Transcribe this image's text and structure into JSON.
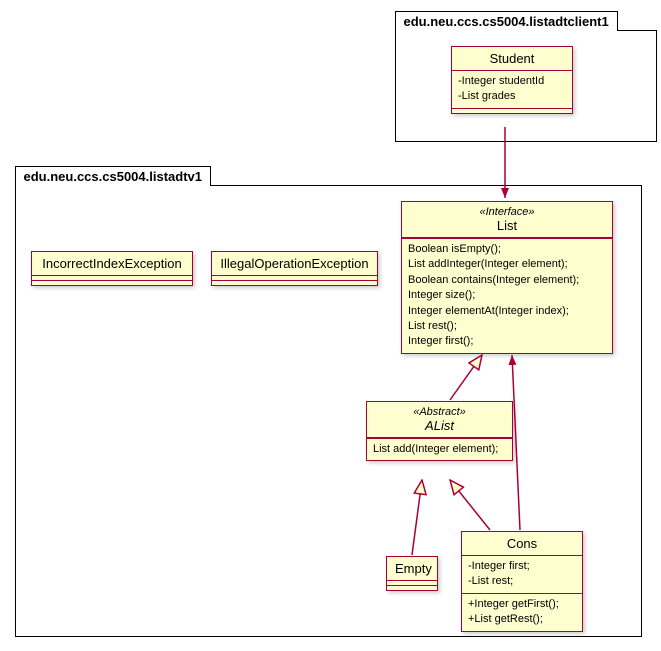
{
  "packages": {
    "client": {
      "name": "edu.neu.ccs.cs5004.listadtclient1"
    },
    "adt": {
      "name": "edu.neu.ccs.cs5004.listadtv1"
    }
  },
  "classes": {
    "student": {
      "name": "Student",
      "fields": [
        "-Integer studentId",
        "-List grades"
      ]
    },
    "incorrectIndex": {
      "name": "IncorrectIndexException"
    },
    "illegalOp": {
      "name": "IllegalOperationException"
    },
    "list": {
      "stereo": "«Interface»",
      "name": "List",
      "methods": [
        "Boolean isEmpty();",
        "List addInteger(Integer element);",
        "Boolean contains(Integer element);",
        "Integer size();",
        "Integer elementAt(Integer index);",
        "List rest();",
        "Integer first();"
      ]
    },
    "alist": {
      "stereo": "«Abstract»",
      "name": "AList",
      "methods": [
        "List add(Integer element);"
      ]
    },
    "empty": {
      "name": "Empty"
    },
    "cons": {
      "name": "Cons",
      "fields": [
        "-Integer first;",
        "-List rest;"
      ],
      "methods": [
        "+Integer getFirst();",
        "+List getRest();"
      ]
    }
  }
}
